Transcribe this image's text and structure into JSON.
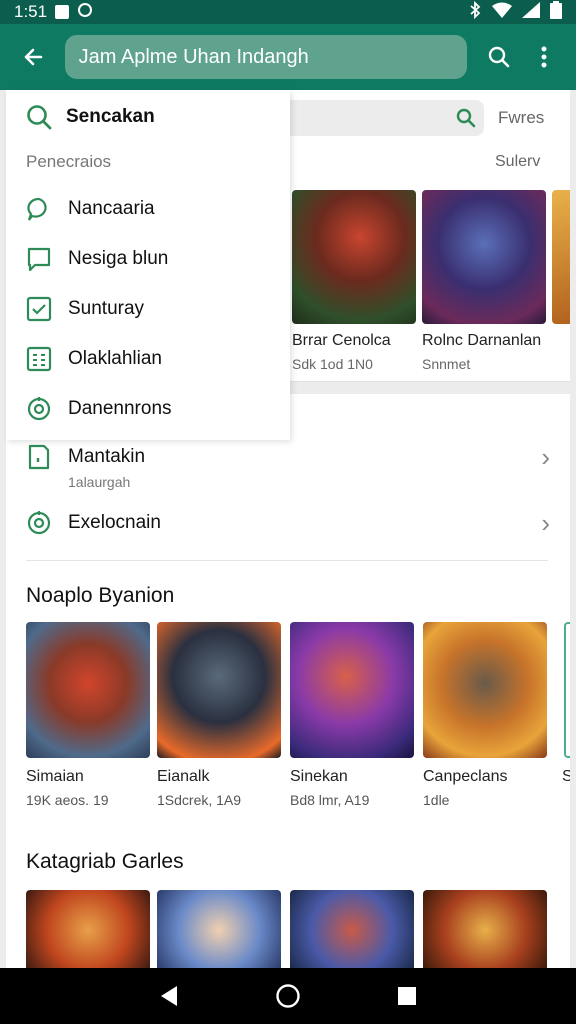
{
  "status_bar": {
    "time": "1:51"
  },
  "app_bar": {
    "search_text": "Jam Aplme Uhan Indangh"
  },
  "background_card": {
    "filter_label": "Fwres",
    "sort_label": "Sulerv",
    "games": [
      {
        "name": "Brrar Cenolca",
        "sub": "Sdk 1od 1N0"
      },
      {
        "name": "Rolnc Darnanlan",
        "sub": "Snnmet"
      }
    ]
  },
  "drawer": {
    "header": "Sencakan",
    "subheader": "Penecraios",
    "items": [
      {
        "label": "Nancaaria",
        "icon": "chat-bubble-icon"
      },
      {
        "label": "Nesiga blun",
        "icon": "message-square-icon"
      },
      {
        "label": "Sunturay",
        "icon": "checkbox-icon"
      },
      {
        "label": "Olaklahlian",
        "icon": "grid-list-icon"
      },
      {
        "label": "Danennrons",
        "icon": "target-icon"
      }
    ]
  },
  "extra_items": [
    {
      "label": "Mantakin",
      "sub": "1alaurgah",
      "icon": "bookmark-icon"
    },
    {
      "label": "Exelocnain",
      "icon": "target-icon"
    }
  ],
  "sections": [
    {
      "title": "Noaplo Byanion",
      "games": [
        {
          "name": "Simaian",
          "sub": "19K aeos. 19"
        },
        {
          "name": "Eianalk",
          "sub": "1Sdcrek, 1A9"
        },
        {
          "name": "Sinekan",
          "sub": "Bd8 lmr, A19"
        },
        {
          "name": "Canpeclans",
          "sub": "1dle"
        }
      ],
      "edge_letter": "S"
    },
    {
      "title": "Katagriab Garles"
    }
  ],
  "colors": {
    "app_bar": "#0f7a62",
    "status_bar": "#0b5e4e",
    "accent": "#2e8b57"
  }
}
